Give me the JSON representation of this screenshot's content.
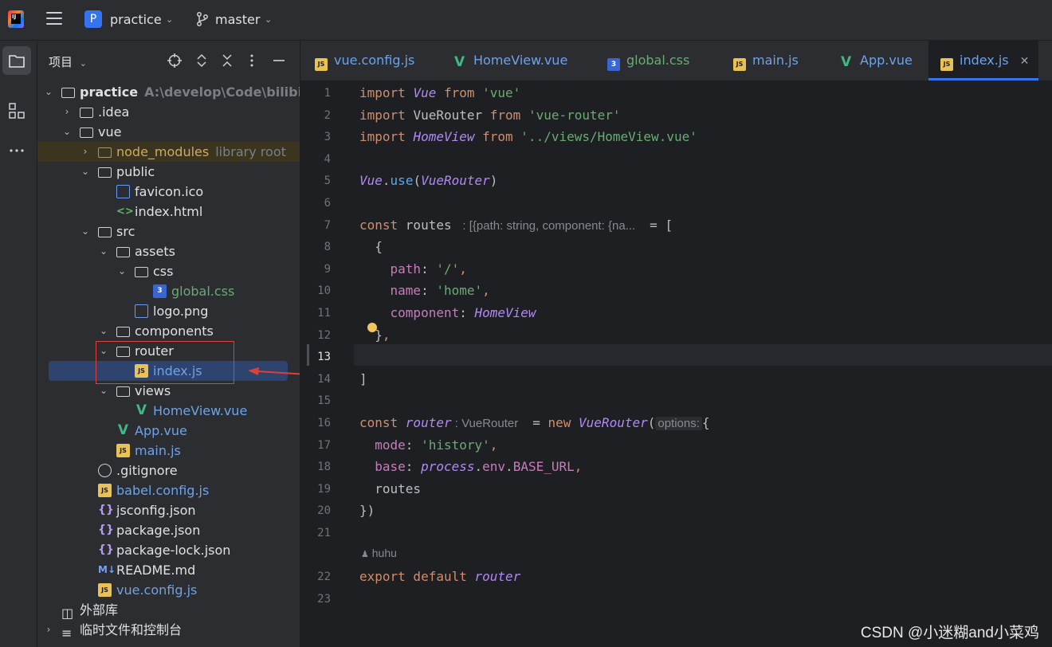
{
  "topbar": {
    "project_badge": "P",
    "project_name": "practice",
    "branch": "master"
  },
  "project_panel": {
    "title": "项目",
    "tree": [
      {
        "label": "practice",
        "hint": "A:\\develop\\Code\\bilibili\\qi",
        "kind": "folder",
        "depth": 0,
        "expanded": true,
        "bold": true
      },
      {
        "label": ".idea",
        "kind": "folder",
        "depth": 1,
        "expanded": false
      },
      {
        "label": "vue",
        "kind": "folder",
        "depth": 1,
        "expanded": true
      },
      {
        "label": "node_modules",
        "hint": "library root",
        "kind": "folder-lib",
        "depth": 2,
        "expanded": false
      },
      {
        "label": "public",
        "kind": "folder",
        "depth": 2,
        "expanded": true
      },
      {
        "label": "favicon.ico",
        "kind": "image",
        "depth": 3
      },
      {
        "label": "index.html",
        "kind": "html",
        "depth": 3
      },
      {
        "label": "src",
        "kind": "folder",
        "depth": 2,
        "expanded": true
      },
      {
        "label": "assets",
        "kind": "folder",
        "depth": 3,
        "expanded": true
      },
      {
        "label": "css",
        "kind": "folder",
        "depth": 4,
        "expanded": true
      },
      {
        "label": "global.css",
        "kind": "css",
        "depth": 5
      },
      {
        "label": "logo.png",
        "kind": "image",
        "depth": 4
      },
      {
        "label": "components",
        "kind": "folder",
        "depth": 3,
        "expanded": true
      },
      {
        "label": "router",
        "kind": "folder",
        "depth": 3,
        "expanded": true
      },
      {
        "label": "index.js",
        "kind": "js",
        "depth": 4,
        "selected": true
      },
      {
        "label": "views",
        "kind": "folder",
        "depth": 3,
        "expanded": true
      },
      {
        "label": "HomeView.vue",
        "kind": "vue",
        "depth": 4
      },
      {
        "label": "App.vue",
        "kind": "vue",
        "depth": 3
      },
      {
        "label": "main.js",
        "kind": "js",
        "depth": 3
      },
      {
        "label": ".gitignore",
        "kind": "git",
        "depth": 2
      },
      {
        "label": "babel.config.js",
        "kind": "js",
        "depth": 2
      },
      {
        "label": "jsconfig.json",
        "kind": "json",
        "depth": 2
      },
      {
        "label": "package.json",
        "kind": "json",
        "depth": 2
      },
      {
        "label": "package-lock.json",
        "kind": "json",
        "depth": 2
      },
      {
        "label": "README.md",
        "kind": "md",
        "depth": 2
      },
      {
        "label": "vue.config.js",
        "kind": "js",
        "depth": 2
      },
      {
        "label": "外部库",
        "kind": "lib",
        "depth": 0
      },
      {
        "label": "临时文件和控制台",
        "kind": "scratch",
        "depth": 0,
        "expanded": false
      }
    ]
  },
  "tabs": [
    {
      "label": "vue.config.js",
      "kind": "js"
    },
    {
      "label": "HomeView.vue",
      "kind": "vue"
    },
    {
      "label": "global.css",
      "kind": "css"
    },
    {
      "label": "main.js",
      "kind": "js"
    },
    {
      "label": "App.vue",
      "kind": "vue"
    },
    {
      "label": "index.js",
      "kind": "js",
      "active": true
    }
  ],
  "colors": {
    "accent": "#3574f0",
    "keyword": "#cf8e6d",
    "string": "#6aab73",
    "class": "#b189f5",
    "property": "#c77dbb",
    "highlight_box": "#e0403a"
  },
  "editor": {
    "current_line": "13",
    "author": "huhu",
    "lines": [
      {
        "n": "1",
        "tokens": [
          [
            "kw",
            "import "
          ],
          [
            "cls",
            "Vue"
          ],
          [
            "kw",
            " from "
          ],
          [
            "str",
            "'vue'"
          ]
        ]
      },
      {
        "n": "2",
        "tokens": [
          [
            "kw",
            "import "
          ],
          [
            "",
            "VueRouter"
          ],
          [
            "kw",
            " from "
          ],
          [
            "str",
            "'vue-router'"
          ]
        ]
      },
      {
        "n": "3",
        "tokens": [
          [
            "kw",
            "import "
          ],
          [
            "cls",
            "HomeView"
          ],
          [
            "kw",
            " from "
          ],
          [
            "str",
            "'../views/HomeView.vue'"
          ]
        ]
      },
      {
        "n": "4",
        "tokens": []
      },
      {
        "n": "5",
        "tokens": [
          [
            "cls",
            "Vue"
          ],
          [
            "",
            ".",
            ""
          ],
          [
            "fn",
            "use"
          ],
          [
            "",
            "("
          ],
          [
            "cls",
            "VueRouter"
          ],
          [
            "",
            ")"
          ]
        ]
      },
      {
        "n": "6",
        "tokens": []
      },
      {
        "n": "7",
        "tokens": [
          [
            "kw",
            "const "
          ],
          [
            "",
            "routes "
          ],
          [
            "hint",
            " : [{path: string, component: {na...  "
          ],
          [
            "",
            " = ["
          ]
        ]
      },
      {
        "n": "8",
        "tokens": [
          [
            "",
            "  {"
          ]
        ]
      },
      {
        "n": "9",
        "tokens": [
          [
            "prop",
            "    path"
          ],
          [
            "",
            ": "
          ],
          [
            "str",
            "'/'"
          ],
          [
            "kw",
            ","
          ]
        ]
      },
      {
        "n": "10",
        "tokens": [
          [
            "prop",
            "    name"
          ],
          [
            "",
            ": "
          ],
          [
            "str",
            "'home'"
          ],
          [
            "kw",
            ","
          ]
        ]
      },
      {
        "n": "11",
        "tokens": [
          [
            "prop",
            "    component"
          ],
          [
            "",
            ": "
          ],
          [
            "cls",
            "HomeView"
          ]
        ]
      },
      {
        "n": "12",
        "tokens": [
          [
            "",
            "  }"
          ],
          [
            "kw",
            ","
          ]
        ]
      },
      {
        "n": "13",
        "tokens": []
      },
      {
        "n": "14",
        "tokens": [
          [
            "",
            "]"
          ]
        ]
      },
      {
        "n": "15",
        "tokens": []
      },
      {
        "n": "16",
        "tokens": [
          [
            "kw",
            "const "
          ],
          [
            "cls",
            "router"
          ],
          [
            "hint",
            " : VueRouter  "
          ],
          [
            "",
            " = "
          ],
          [
            "kw",
            "new "
          ],
          [
            "cls",
            "VueRouter"
          ],
          [
            "",
            "("
          ],
          [
            "hintbox",
            "options:"
          ],
          [
            "",
            "{"
          ]
        ]
      },
      {
        "n": "17",
        "tokens": [
          [
            "prop",
            "  mode"
          ],
          [
            "",
            ": "
          ],
          [
            "str",
            "'history'"
          ],
          [
            "kw",
            ","
          ]
        ]
      },
      {
        "n": "18",
        "tokens": [
          [
            "prop",
            "  base"
          ],
          [
            "",
            ": "
          ],
          [
            "cls",
            "process"
          ],
          [
            "",
            "."
          ],
          [
            "prop",
            "env"
          ],
          [
            "",
            "."
          ],
          [
            "prop",
            "BASE_URL"
          ],
          [
            "kw",
            ","
          ]
        ]
      },
      {
        "n": "19",
        "tokens": [
          [
            "",
            "  routes"
          ]
        ]
      },
      {
        "n": "20",
        "tokens": [
          [
            "",
            "})"
          ]
        ]
      },
      {
        "n": "21",
        "tokens": []
      },
      {
        "n": "22",
        "tokens": [
          [
            "kw",
            "export default "
          ],
          [
            "cls",
            "router"
          ]
        ]
      },
      {
        "n": "23",
        "tokens": []
      }
    ]
  },
  "watermark": "CSDN @小迷糊and小菜鸡"
}
